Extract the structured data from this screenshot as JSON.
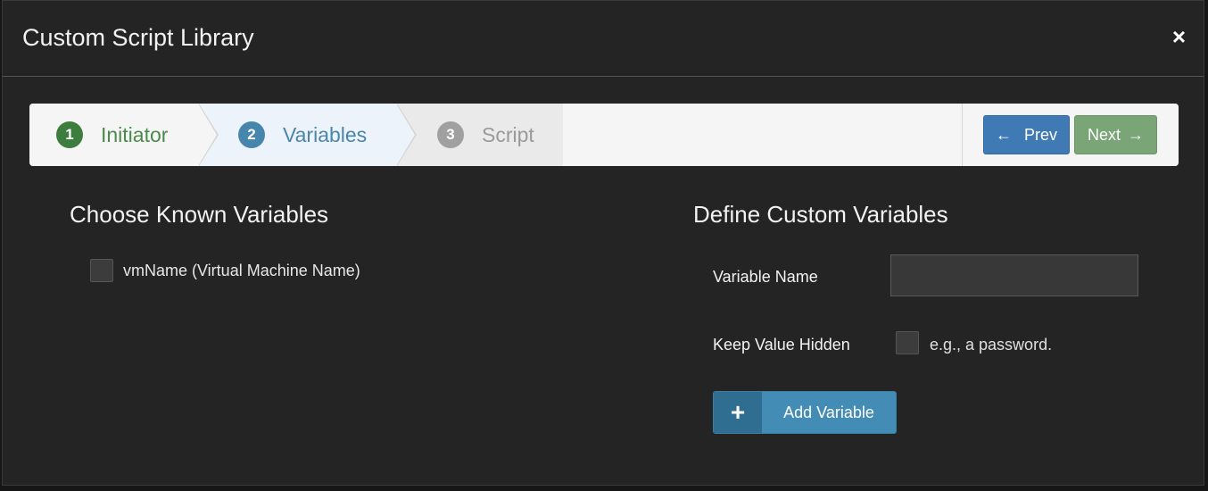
{
  "modal": {
    "title": "Custom Script Library",
    "close_label": "×"
  },
  "wizard": {
    "steps": [
      {
        "number": "1",
        "label": "Initiator",
        "state": "completed"
      },
      {
        "number": "2",
        "label": "Variables",
        "state": "active"
      },
      {
        "number": "3",
        "label": "Script",
        "state": "pending"
      }
    ],
    "prev_icon": "←",
    "prev_label": "Prev",
    "next_label": "Next",
    "next_icon": "→"
  },
  "known_variables": {
    "title": "Choose Known Variables",
    "items": [
      {
        "label": "vmName (Virtual Machine Name)",
        "checked": false
      }
    ]
  },
  "custom_variables": {
    "title": "Define Custom Variables",
    "variable_name_label": "Variable Name",
    "variable_name_value": "",
    "keep_hidden_label": "Keep Value Hidden",
    "keep_hidden_hint": "e.g., a password.",
    "add_icon": "+",
    "add_label": "Add Variable"
  },
  "colors": {
    "completed_step": "#3d7d3d",
    "active_step": "#4686ad",
    "pending_step": "#a0a0a0",
    "prev_button": "#3f7ab5",
    "next_button": "#79a577",
    "add_button": "#428cb6"
  }
}
